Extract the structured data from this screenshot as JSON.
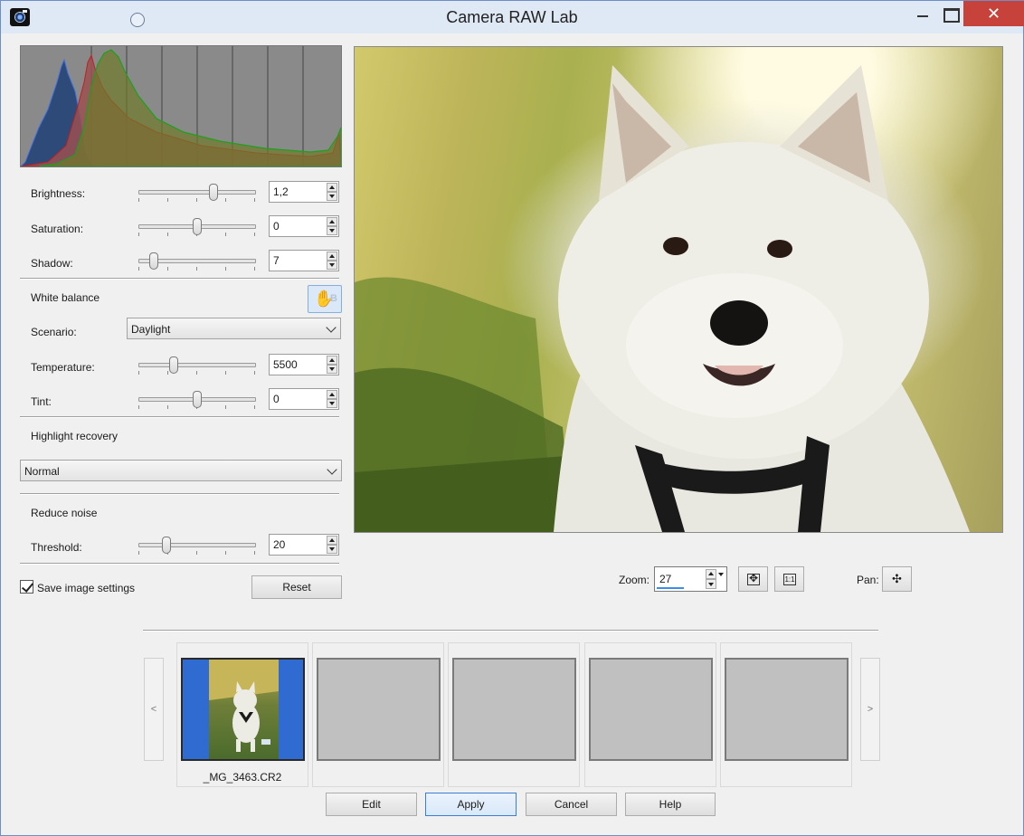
{
  "window": {
    "title": "Camera RAW Lab",
    "close_glyph": "✕"
  },
  "adjust": {
    "brightness": {
      "label": "Brightness:",
      "value": "1,2",
      "level": 0.65
    },
    "saturation": {
      "label": "Saturation:",
      "value": "0",
      "level": 0.5
    },
    "shadow": {
      "label": "Shadow:",
      "value": "7",
      "level": 0.1
    }
  },
  "white_balance": {
    "title": "White balance",
    "scenario_label": "Scenario:",
    "scenario_value": "Daylight",
    "temperature": {
      "label": "Temperature:",
      "value": "5500",
      "level": 0.28
    },
    "tint": {
      "label": "Tint:",
      "value": "0",
      "level": 0.5
    },
    "picker_letter": "B"
  },
  "highlight": {
    "title": "Highlight recovery",
    "value": "Normal"
  },
  "noise": {
    "title": "Reduce noise",
    "threshold": {
      "label": "Threshold:",
      "value": "20",
      "level": 0.22
    }
  },
  "options": {
    "save_settings_label": "Save image settings",
    "save_settings_checked": true,
    "reset_label": "Reset"
  },
  "view": {
    "zoom_label": "Zoom:",
    "zoom_value": "27",
    "fit_icon": "fit-to-window-icon",
    "actual_icon": "actual-size-icon",
    "actual_text": "1:1",
    "pan_label": "Pan:",
    "pan_icon": "pan-icon",
    "pan_glyph": "✣"
  },
  "filmstrip": {
    "prev_glyph": "<",
    "next_glyph": ">",
    "thumbs": [
      {
        "caption": "_MG_3463.CR2",
        "active": true
      },
      {
        "caption": "",
        "active": false
      },
      {
        "caption": "",
        "active": false
      },
      {
        "caption": "",
        "active": false
      },
      {
        "caption": "",
        "active": false
      }
    ]
  },
  "footer": {
    "edit_label": "Edit",
    "apply_label": "Apply",
    "cancel_label": "Cancel",
    "help_label": "Help"
  },
  "colors": {
    "titlebar": "#dfe9f5",
    "close_button": "#c7423a",
    "selection": "#2f6bd0",
    "histogram_blue": "#2e4a78",
    "histogram_red": "#b02020",
    "histogram_green": "#1ea01e"
  }
}
